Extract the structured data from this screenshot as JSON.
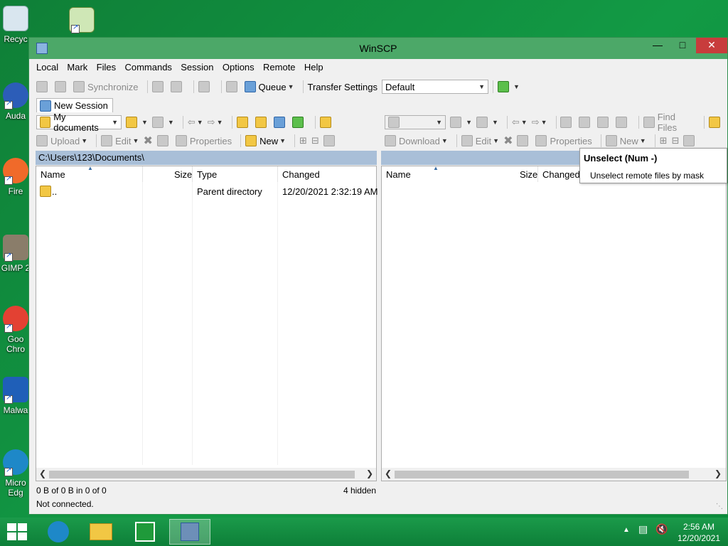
{
  "desktop": {
    "icons": [
      {
        "label": "Recyc",
        "name": "recycle-bin"
      },
      {
        "label": "Auda",
        "name": "audacity"
      },
      {
        "label": "Fire",
        "name": "firefox"
      },
      {
        "label": "GIMP 2",
        "name": "gimp"
      },
      {
        "label": "Goo",
        "label2": "Chro",
        "name": "google-chrome"
      },
      {
        "label": "Malwa",
        "name": "malwarebytes"
      },
      {
        "label": "Micro",
        "label2": "Edg",
        "name": "microsoft-edge"
      }
    ]
  },
  "window": {
    "title": "WinSCP",
    "menu": [
      "Local",
      "Mark",
      "Files",
      "Commands",
      "Session",
      "Options",
      "Remote",
      "Help"
    ],
    "toolbar1": {
      "synchronize": "Synchronize",
      "queue": "Queue",
      "transfer_settings_label": "Transfer Settings",
      "transfer_settings_value": "Default"
    },
    "session_tab": "New Session",
    "left": {
      "location": "My documents",
      "upload": "Upload",
      "edit": "Edit",
      "properties": "Properties",
      "new": "New",
      "path": "C:\\Users\\123\\Documents\\",
      "columns": {
        "name": "Name",
        "size": "Size",
        "type": "Type",
        "changed": "Changed"
      },
      "rows": [
        {
          "name": "..",
          "size": "",
          "type": "Parent directory",
          "changed": "12/20/2021  2:32:19 AM"
        }
      ]
    },
    "right": {
      "find_files": "Find Files",
      "download": "Download",
      "edit": "Edit",
      "properties": "Properties",
      "new": "New",
      "columns": {
        "name": "Name",
        "size": "Size",
        "changed": "Changed"
      }
    },
    "status": {
      "left_summary": "0 B of 0 B in 0 of 0",
      "hidden": "4 hidden",
      "connection": "Not connected."
    },
    "tooltip": {
      "title": "Unselect (Num -)",
      "description": "Unselect remote files by mask"
    }
  },
  "taskbar": {
    "time": "2:56 AM",
    "date": "12/20/2021"
  },
  "colors": {
    "desktop": "#129a45",
    "titlebar": "#4ca868",
    "close": "#c83c3c",
    "path_bar": "#a9bfd8"
  }
}
